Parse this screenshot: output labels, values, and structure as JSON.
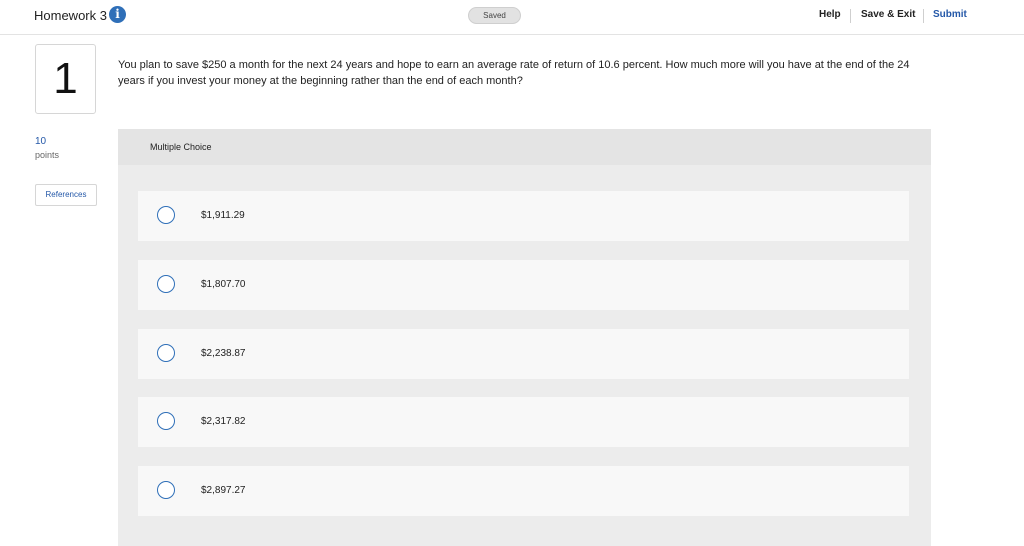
{
  "header": {
    "title": "Homework 3",
    "info_icon": "info-icon",
    "saved_status": "Saved",
    "help": "Help",
    "save_exit": "Save & Exit",
    "submit": "Submit",
    "accent_color": "#2f6fb8"
  },
  "sidebar": {
    "question_number": "1",
    "points_value": "10",
    "points_label": "points",
    "references": "References"
  },
  "question": {
    "text": "You plan to save $250 a month for the next 24 years and hope to earn an average rate of return of 10.6 percent. How much more will you have at the end of the 24 years if you invest your money at the beginning rather than the end of each month?"
  },
  "multiple_choice": {
    "label": "Multiple Choice",
    "options": [
      "$1,911.29",
      "$1,807.70",
      "$2,238.87",
      "$2,317.82",
      "$2,897.27"
    ]
  }
}
